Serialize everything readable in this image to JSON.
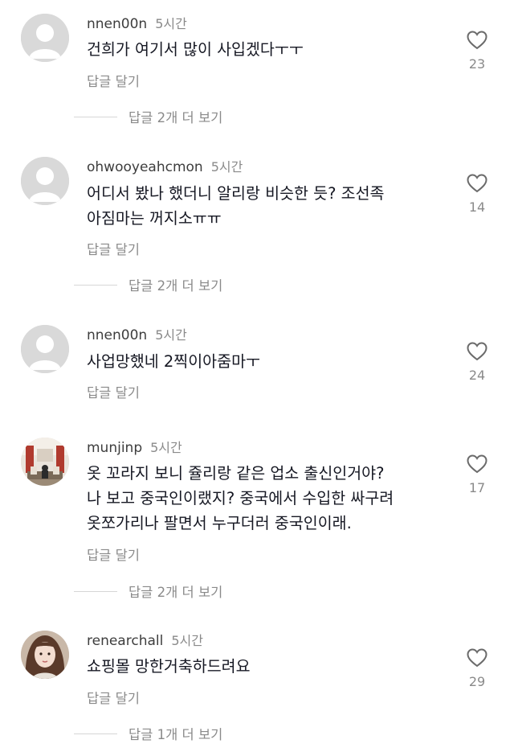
{
  "comments": [
    {
      "username": "nnen00n",
      "time": "5시간",
      "lines": [
        "건희가 여기서 많이 사입겠다ㅜㅜ"
      ],
      "reply_label": "답글 달기",
      "likes": "23",
      "more_replies": "답글 2개 더 보기",
      "avatar": "default-avatar"
    },
    {
      "username": "ohwooyeahcmon",
      "time": "5시간",
      "lines": [
        "어디서 봤나 했더니 알리랑 비슷한 듯? 조선족",
        "아짐마는 꺼지소ㅠㅠ"
      ],
      "reply_label": "답글 달기",
      "likes": "14",
      "more_replies": "답글 2개 더 보기",
      "avatar": "default-avatar"
    },
    {
      "username": "nnen00n",
      "time": "5시간",
      "lines": [
        "사업망했네 2찍이아줌마ㅜ"
      ],
      "reply_label": "답글 달기",
      "likes": "24",
      "avatar": "default-avatar"
    },
    {
      "username": "munjinp",
      "time": "5시간",
      "lines": [
        "옷 꼬라지 보니 쥴리랑 같은 업소 출신인거야?",
        "나 보고 중국인이랬지? 중국에서 수입한 싸구려",
        "옷쪼가리나 팔면서 누구더러 중국인이래."
      ],
      "reply_label": "답글 달기",
      "likes": "17",
      "more_replies": "답글 2개 더 보기",
      "avatar": "photo-avatar-room"
    },
    {
      "username": "renearchall",
      "time": "5시간",
      "lines": [
        "쇼핑몰 망한거축하드려요"
      ],
      "reply_label": "답글 달기",
      "likes": "29",
      "more_replies": "답글 1개 더 보기",
      "avatar": "photo-avatar-portrait"
    }
  ],
  "icons": {
    "like": "heart-outline-icon"
  },
  "colors": {
    "text": "#161823",
    "muted": "#8a8a8a",
    "divider": "#d6d6d6"
  }
}
